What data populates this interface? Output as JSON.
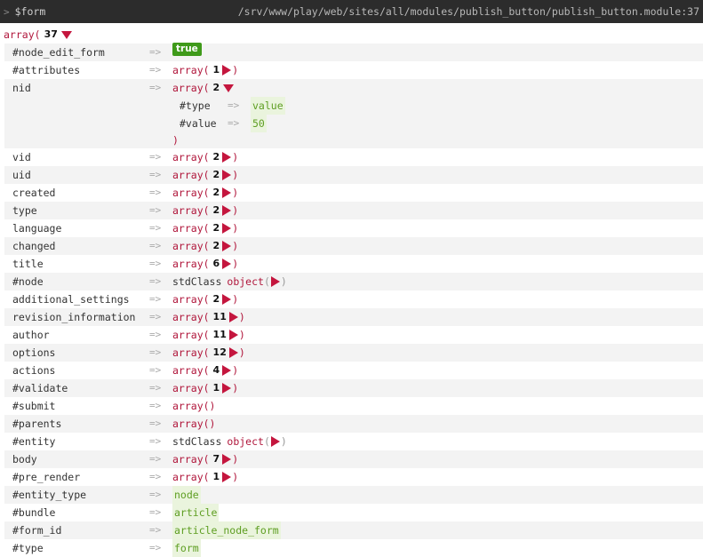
{
  "header": {
    "prompt": ">",
    "variable": "$form",
    "path": "/srv/www/play/web/sites/all/modules/publish_button/publish_button.module:37"
  },
  "root": {
    "type": "array",
    "open": "(",
    "count": "37"
  },
  "arrow": "=>",
  "rows": [
    {
      "key": "#node_edit_form",
      "kind": "bool",
      "value": "true"
    },
    {
      "key": "#attributes",
      "kind": "array",
      "count": "1"
    },
    {
      "key": "nid",
      "kind": "array_open",
      "count": "2",
      "children": [
        {
          "key": "#type",
          "value": "value"
        },
        {
          "key": "#value",
          "value": "50"
        }
      ],
      "close": ")"
    },
    {
      "key": "vid",
      "kind": "array",
      "count": "2"
    },
    {
      "key": "uid",
      "kind": "array",
      "count": "2"
    },
    {
      "key": "created",
      "kind": "array",
      "count": "2"
    },
    {
      "key": "type",
      "kind": "array",
      "count": "2"
    },
    {
      "key": "language",
      "kind": "array",
      "count": "2"
    },
    {
      "key": "changed",
      "kind": "array",
      "count": "2"
    },
    {
      "key": "title",
      "kind": "array",
      "count": "6"
    },
    {
      "key": "#node",
      "kind": "object",
      "class": "stdClass",
      "label": "object"
    },
    {
      "key": "additional_settings",
      "kind": "array",
      "count": "2"
    },
    {
      "key": "revision_information",
      "kind": "array",
      "count": "11"
    },
    {
      "key": "author",
      "kind": "array",
      "count": "11"
    },
    {
      "key": "options",
      "kind": "array",
      "count": "12"
    },
    {
      "key": "actions",
      "kind": "array",
      "count": "4"
    },
    {
      "key": "#validate",
      "kind": "array",
      "count": "1"
    },
    {
      "key": "#submit",
      "kind": "empty",
      "value": "array()"
    },
    {
      "key": "#parents",
      "kind": "empty",
      "value": "array()"
    },
    {
      "key": "#entity",
      "kind": "object",
      "class": "stdClass",
      "label": "object"
    },
    {
      "key": "body",
      "kind": "array",
      "count": "7"
    },
    {
      "key": "#pre_render",
      "kind": "array",
      "count": "1"
    },
    {
      "key": "#entity_type",
      "kind": "string",
      "value": "node"
    },
    {
      "key": "#bundle",
      "kind": "string",
      "value": "article"
    },
    {
      "key": "#form_id",
      "kind": "string",
      "value": "article_node_form"
    },
    {
      "key": "#type",
      "kind": "string",
      "value": "form"
    }
  ],
  "colors": {
    "header_bg": "#2c2c2c",
    "keyword": "#b0163b",
    "toggle": "#c4163e",
    "bool_bg": "#3f9a1a",
    "string": "#5e9e22"
  }
}
